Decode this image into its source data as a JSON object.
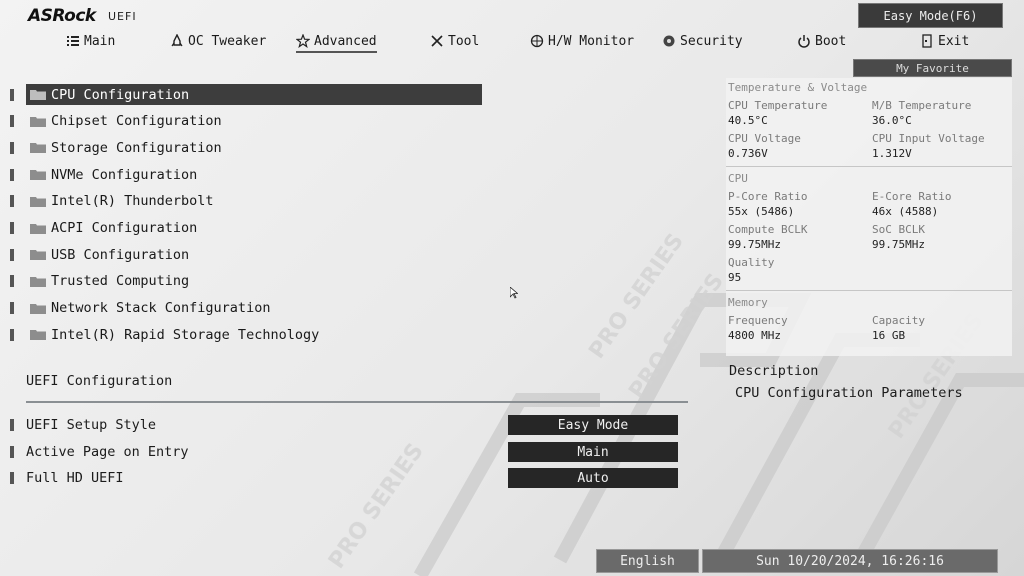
{
  "brand": {
    "logo": "ASRock",
    "sub": "UEFI"
  },
  "header": {
    "easy_mode": "Easy Mode(F6)",
    "my_favorite": "My Favorite"
  },
  "tabs": [
    {
      "label": "Main",
      "icon": "list-icon"
    },
    {
      "label": "OC Tweaker",
      "icon": "rocket-icon"
    },
    {
      "label": "Advanced",
      "icon": "star-icon",
      "active": true
    },
    {
      "label": "Tool",
      "icon": "tools-icon"
    },
    {
      "label": "H/W Monitor",
      "icon": "crosshair-icon"
    },
    {
      "label": "Security",
      "icon": "shield-icon"
    },
    {
      "label": "Boot",
      "icon": "power-icon"
    },
    {
      "label": "Exit",
      "icon": "exit-icon"
    }
  ],
  "menu": [
    {
      "label": "CPU Configuration",
      "selected": true
    },
    {
      "label": "Chipset Configuration"
    },
    {
      "label": "Storage Configuration"
    },
    {
      "label": "NVMe Configuration"
    },
    {
      "label": "Intel(R) Thunderbolt"
    },
    {
      "label": "ACPI Configuration"
    },
    {
      "label": "USB Configuration"
    },
    {
      "label": "Trusted Computing"
    },
    {
      "label": "Network Stack Configuration"
    },
    {
      "label": "Intel(R) Rapid Storage Technology"
    }
  ],
  "uefi_config": {
    "title": "UEFI Configuration",
    "options": [
      {
        "label": "UEFI Setup Style",
        "value": "Easy Mode"
      },
      {
        "label": "Active Page on Entry",
        "value": "Main"
      },
      {
        "label": "Full HD UEFI",
        "value": "Auto"
      }
    ]
  },
  "monitor": {
    "temp_title": "Temperature & Voltage",
    "cpu_temp_label": "CPU Temperature",
    "cpu_temp": "40.5°C",
    "mb_temp_label": "M/B Temperature",
    "mb_temp": "36.0°C",
    "cpu_volt_label": "CPU Voltage",
    "cpu_volt": "0.736V",
    "cpu_in_volt_label": "CPU Input Voltage",
    "cpu_in_volt": "1.312V",
    "cpu_title": "CPU",
    "pcore_label": "P-Core Ratio",
    "pcore": "55x (5486)",
    "ecore_label": "E-Core Ratio",
    "ecore": "46x (4588)",
    "cbclk_label": "Compute BCLK",
    "cbclk": "99.75MHz",
    "socbclk_label": "SoC BCLK",
    "socbclk": "99.75MHz",
    "quality_label": "Quality",
    "quality": "95",
    "mem_title": "Memory",
    "freq_label": "Frequency",
    "freq": "4800 MHz",
    "cap_label": "Capacity",
    "cap": "16 GB"
  },
  "description": {
    "title": "Description",
    "text": "CPU Configuration Parameters"
  },
  "footer": {
    "language": "English",
    "datetime": "Sun 10/20/2024, 16:26:16"
  }
}
